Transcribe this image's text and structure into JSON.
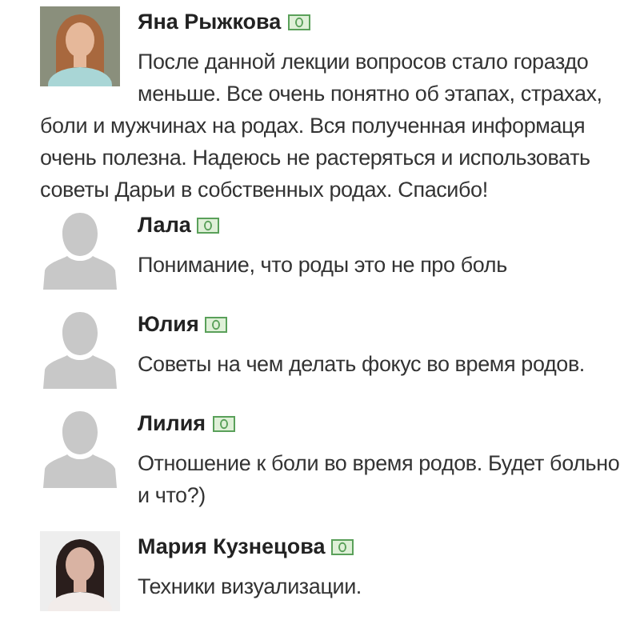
{
  "comments": [
    {
      "kind": "wrapped",
      "name": "Яна Рыжкова",
      "text": "После данной лекции вопросов стало гораздо меньше. Все очень понятно об этапах, страхах, боли и мужчинах на родах. Вся полученная информаця очень полезна. Надеюсь не растеряться и использовать советы Дарьи в собственных родах. Спасибо!"
    },
    {
      "kind": "indented",
      "avatar": {
        "kind": "silhouette"
      },
      "name": "Лала",
      "text": "Понимание, что роды это не про боль"
    },
    {
      "kind": "indented",
      "avatar": {
        "kind": "silhouette"
      },
      "name": "Юлия",
      "text": "Советы на чем делать фокус во время родов."
    },
    {
      "kind": "indented",
      "avatar": {
        "kind": "silhouette"
      },
      "name": "Лилия",
      "text": "Отношение к боли во время родов. Будет больно и что?)"
    },
    {
      "kind": "indented",
      "name": "Мария Кузнецова",
      "text": "Техники визуализации."
    }
  ]
}
